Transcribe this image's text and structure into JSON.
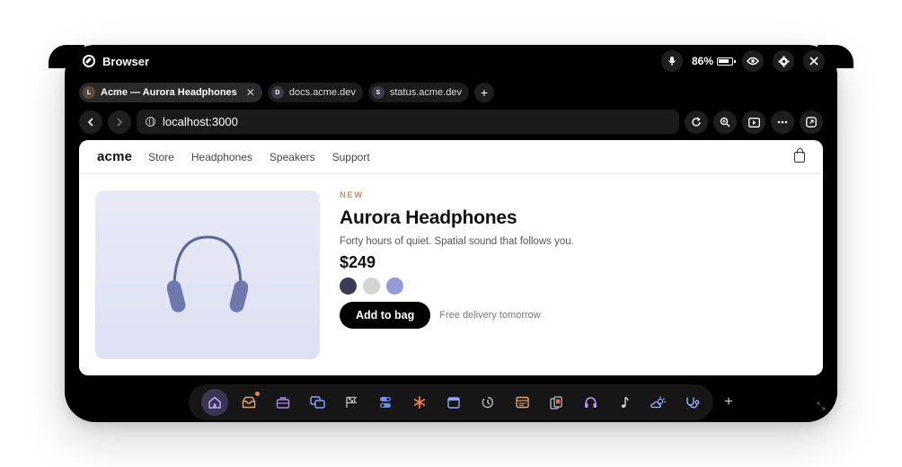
{
  "app": {
    "title": "Browser",
    "battery_percent": "86%",
    "battery_level": 0.86
  },
  "tabs": [
    {
      "badge": "L",
      "label": "Acme — Aurora Headphones",
      "active": true
    },
    {
      "badge": "D",
      "label": "docs.acme.dev",
      "active": false
    },
    {
      "badge": "S",
      "label": "status.acme.dev",
      "active": false
    }
  ],
  "address": {
    "url": "localhost:3000"
  },
  "site": {
    "brand": "acme",
    "nav": [
      "Store",
      "Headphones",
      "Speakers",
      "Support"
    ]
  },
  "product": {
    "tag": "NEW",
    "name": "Aurora Headphones",
    "tagline": "Forty hours of quiet. Spatial sound that follows you.",
    "price": "$249",
    "swatches": [
      "#3c3a55",
      "#d4d4d4",
      "#959bd8"
    ],
    "cta": "Add to bag",
    "delivery": "Free delivery tomorrow"
  },
  "dock": {
    "items": [
      "home-icon",
      "inbox-icon",
      "briefcase-icon",
      "windows-icon",
      "flag-icon",
      "toggles-icon",
      "asterisk-icon",
      "calendar-icon",
      "timer-icon",
      "notes-icon",
      "cards-icon",
      "headphones-icon",
      "music-icon",
      "weather-icon",
      "stethoscope-icon"
    ],
    "active": "home-icon",
    "notification_on": "inbox-icon"
  },
  "colors": {
    "accent": "#d98a4e",
    "dock_active": "#3a3550",
    "headphone": "#5d6796"
  }
}
